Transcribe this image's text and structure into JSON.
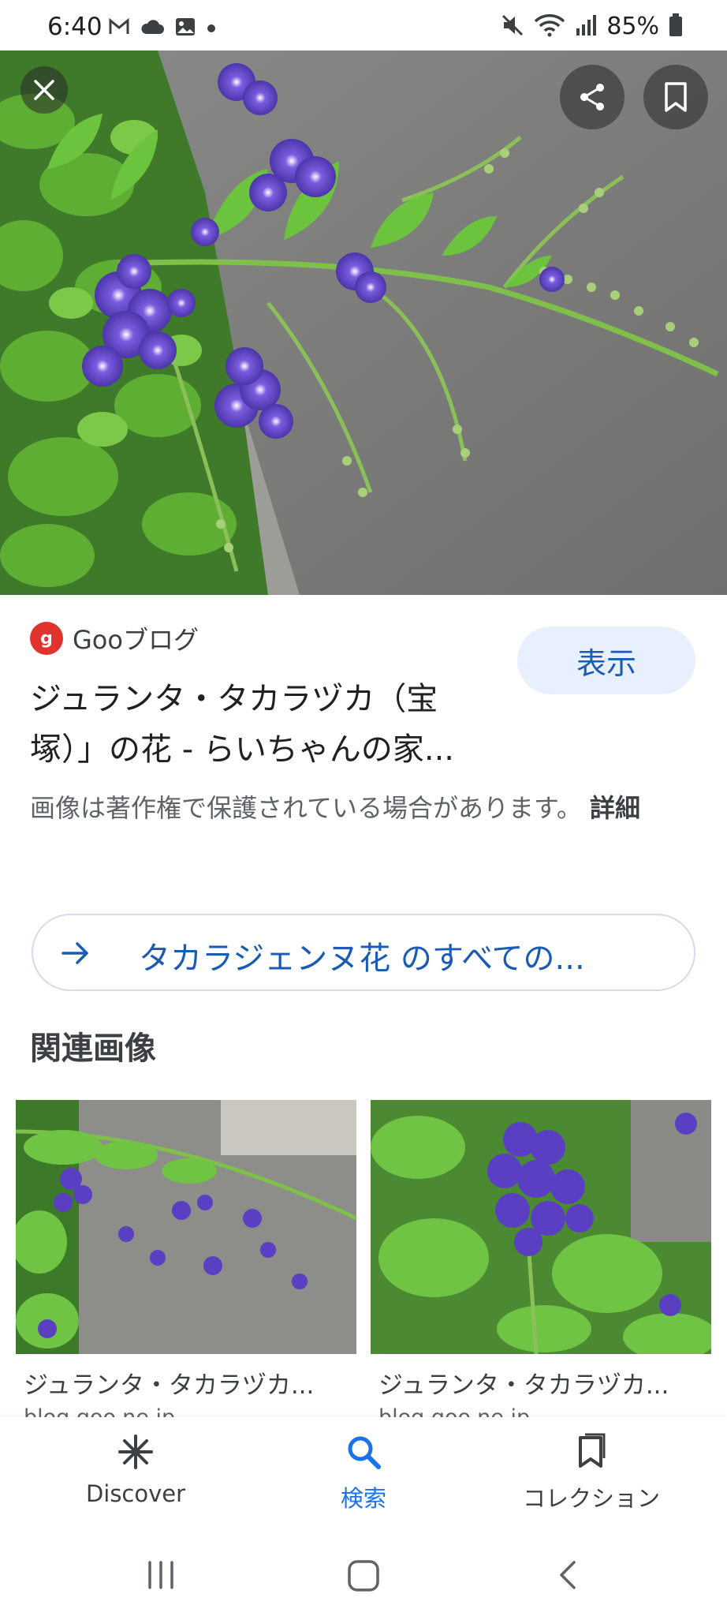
{
  "status_bar": {
    "time": "6:40",
    "battery": "85%",
    "left_icons": [
      "gmail-icon",
      "cloud-icon",
      "gallery-icon",
      "dot-icon"
    ],
    "right_icons": [
      "mute-icon",
      "wifi-icon",
      "signal-icon",
      "battery-icon"
    ]
  },
  "viewer": {
    "close_icon": "close-icon",
    "share_icon": "share-icon",
    "bookmark_icon": "bookmark-icon"
  },
  "result": {
    "source_logo_text": "g",
    "source_name": "Gooブログ",
    "title_line1": "ジュランタ・タカラヅカ（宝",
    "title_line2": "塚）」の花 - らいちゃんの家...",
    "visit_label": "表示",
    "copyright_text": "画像は著作権で保護されている場合があります。",
    "copyright_link": "詳細"
  },
  "see_all": {
    "label": "タカラジェンヌ花 のすべての..."
  },
  "related": {
    "heading": "関連画像",
    "items": [
      {
        "title": "ジュランタ・タカラヅカ...",
        "domain": "blog.goo.ne.jp"
      },
      {
        "title": "ジュランタ・タカラヅカ...",
        "domain": "blog.goo.ne.jp"
      }
    ]
  },
  "bottom_nav": {
    "items": [
      {
        "label": "Discover",
        "icon": "asterisk-icon",
        "active": false
      },
      {
        "label": "検索",
        "icon": "search-icon",
        "active": true
      },
      {
        "label": "コレクション",
        "icon": "collections-icon",
        "active": false
      }
    ]
  },
  "colors": {
    "accent": "#1a73e8",
    "link_blue": "#1a5bb5",
    "visit_button_bg": "#e8f0fe",
    "flower_purple": "#5b3fc4"
  }
}
